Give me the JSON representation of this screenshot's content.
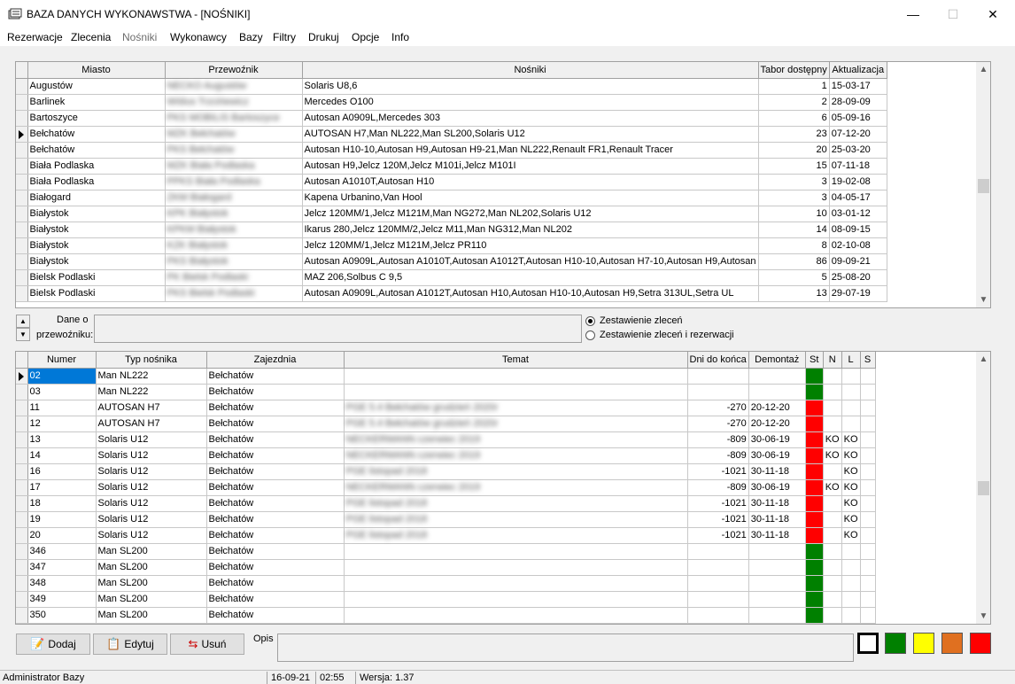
{
  "window": {
    "title": "BAZA DANYCH WYKONAWSTWA - [NOŚNIKI]",
    "minimize": "—",
    "restore": "☐",
    "close": "✕"
  },
  "menu": [
    "Rezerwacje",
    "Zlecenia",
    "Nośniki",
    "Wykonawcy",
    "Bazy",
    "Filtry",
    "Drukuj",
    "Opcje",
    "Info"
  ],
  "carriers": {
    "columns": [
      "Miasto",
      "Przewoźnik",
      "Nośniki",
      "Tabor dostępny",
      "Aktualizacja"
    ],
    "rows": [
      [
        "Augustów",
        "NECKO Augustów",
        "Solaris U8,6",
        "1",
        "15-03-17"
      ],
      [
        "Barlinek",
        "Wiślus Trzcińewicz",
        "Mercedes O100",
        "2",
        "28-09-09"
      ],
      [
        "Bartoszyce",
        "PKS MOBILIS Bartoszyce",
        "Autosan A0909L,Mercedes 303",
        "6",
        "05-09-16"
      ],
      [
        "Bełchatów",
        "MZK Bełchatów",
        "AUTOSAN H7,Man NL222,Man SL200,Solaris U12",
        "23",
        "07-12-20"
      ],
      [
        "Bełchatów",
        "PKS Bełchatów",
        "Autosan H10-10,Autosan H9,Autosan H9-21,Man NL222,Renault FR1,Renault Tracer",
        "20",
        "25-03-20"
      ],
      [
        "Biała Podlaska",
        "MZK Biała Podlaska",
        "Autosan H9,Jelcz 120M,Jelcz M101i,Jelcz M101I",
        "15",
        "07-11-18"
      ],
      [
        "Biała Podlaska",
        "PPKS Biała Podlaska",
        "Autosan A1010T,Autosan H10",
        "3",
        "19-02-08"
      ],
      [
        "Białogard",
        "ZKM Białogard",
        "Kapena Urbanino,Van Hool",
        "3",
        "04-05-17"
      ],
      [
        "Białystok",
        "KPK Białystok",
        "Jelcz 120MM/1,Jelcz M121M,Man NG272,Man NL202,Solaris U12",
        "10",
        "03-01-12"
      ],
      [
        "Białystok",
        "KPKM Białystok",
        "Ikarus 280,Jelcz 120MM/2,Jelcz M11,Man NG312,Man NL202",
        "14",
        "08-09-15"
      ],
      [
        "Białystok",
        "KZK Białystok",
        "Jelcz 120MM/1,Jelcz M121M,Jelcz PR110",
        "8",
        "02-10-08"
      ],
      [
        "Białystok",
        "PKS Białystok",
        "Autosan A0909L,Autosan A1010T,Autosan A1012T,Autosan H10-10,Autosan H7-10,Autosan H9,Autosan",
        "86",
        "09-09-21"
      ],
      [
        "Bielsk Podlaski",
        "PK Bielsk Podlaski",
        "MAZ 206,Solbus C 9,5",
        "5",
        "25-08-20"
      ],
      [
        "Bielsk Podlaski",
        "PKS Bielsk Podlaski",
        "Autosan A0909L,Autosan A1012T,Autosan H10,Autosan H10-10,Autosan H9,Setra 313UL,Setra UL",
        "13",
        "29-07-19"
      ]
    ],
    "current_row": 3
  },
  "mid": {
    "dane_o": "Dane o",
    "przewozniku": "przewoźniku:",
    "radio_1": "Zestawienie zleceń",
    "radio_2": "Zestawienie zleceń i rezerwacji"
  },
  "vehicles": {
    "columns": [
      "Numer",
      "Typ nośnika",
      "Zajezdnia",
      "Temat",
      "Dni do końca",
      "Demontaż",
      "St",
      "N",
      "L",
      "S"
    ],
    "rows": [
      [
        "02",
        "Man NL222",
        "Bełchatów",
        "",
        "",
        "",
        "green",
        "",
        "",
        ""
      ],
      [
        "03",
        "Man NL222",
        "Bełchatów",
        "",
        "",
        "",
        "green",
        "",
        "",
        ""
      ],
      [
        "11",
        "AUTOSAN H7",
        "Bełchatów",
        "PGE 5.4 Bełchatów grudzień 2020r",
        "-270",
        "20-12-20",
        "red",
        "",
        "",
        ""
      ],
      [
        "12",
        "AUTOSAN H7",
        "Bełchatów",
        "PGE 5.4 Bełchatów grudzień 2020r",
        "-270",
        "20-12-20",
        "red",
        "",
        "",
        ""
      ],
      [
        "13",
        "Solaris U12",
        "Bełchatów",
        "NECKERMANN czerwiec 2019",
        "-809",
        "30-06-19",
        "red",
        "KO",
        "KO",
        ""
      ],
      [
        "14",
        "Solaris U12",
        "Bełchatów",
        "NECKERMANN czerwiec 2019",
        "-809",
        "30-06-19",
        "red",
        "KO",
        "KO",
        ""
      ],
      [
        "16",
        "Solaris U12",
        "Bełchatów",
        "PGE listopad 2018",
        "-1021",
        "30-11-18",
        "red",
        "",
        "KO",
        ""
      ],
      [
        "17",
        "Solaris U12",
        "Bełchatów",
        "NECKERMANN czerwiec 2019",
        "-809",
        "30-06-19",
        "red",
        "KO",
        "KO",
        ""
      ],
      [
        "18",
        "Solaris U12",
        "Bełchatów",
        "PGE listopad 2018",
        "-1021",
        "30-11-18",
        "red",
        "",
        "KO",
        ""
      ],
      [
        "19",
        "Solaris U12",
        "Bełchatów",
        "PGE listopad 2018",
        "-1021",
        "30-11-18",
        "red",
        "",
        "KO",
        ""
      ],
      [
        "20",
        "Solaris U12",
        "Bełchatów",
        "PGE listopad 2018",
        "-1021",
        "30-11-18",
        "red",
        "",
        "KO",
        ""
      ],
      [
        "346",
        "Man SL200",
        "Bełchatów",
        "",
        "",
        "",
        "green",
        "",
        "",
        ""
      ],
      [
        "347",
        "Man SL200",
        "Bełchatów",
        "",
        "",
        "",
        "green",
        "",
        "",
        ""
      ],
      [
        "348",
        "Man SL200",
        "Bełchatów",
        "",
        "",
        "",
        "green",
        "",
        "",
        ""
      ],
      [
        "349",
        "Man SL200",
        "Bełchatów",
        "",
        "",
        "",
        "green",
        "",
        "",
        ""
      ],
      [
        "350",
        "Man SL200",
        "Bełchatów",
        "",
        "",
        "",
        "green",
        "",
        "",
        ""
      ]
    ],
    "current_row": 0
  },
  "buttons": {
    "add": "Dodaj",
    "edit": "Edytuj",
    "delete": "Usuń",
    "opis": "Opis"
  },
  "colors": {
    "swatches": [
      "#ffffff",
      "#008000",
      "#ffff00",
      "#e07020",
      "#ff0000"
    ],
    "status_green": "#008000",
    "status_red": "#ff0000",
    "selection": "#0078d7"
  },
  "status": {
    "user": "Administrator Bazy",
    "date": "16-09-21",
    "time": "02:55",
    "version": "Wersja: 1.37"
  }
}
